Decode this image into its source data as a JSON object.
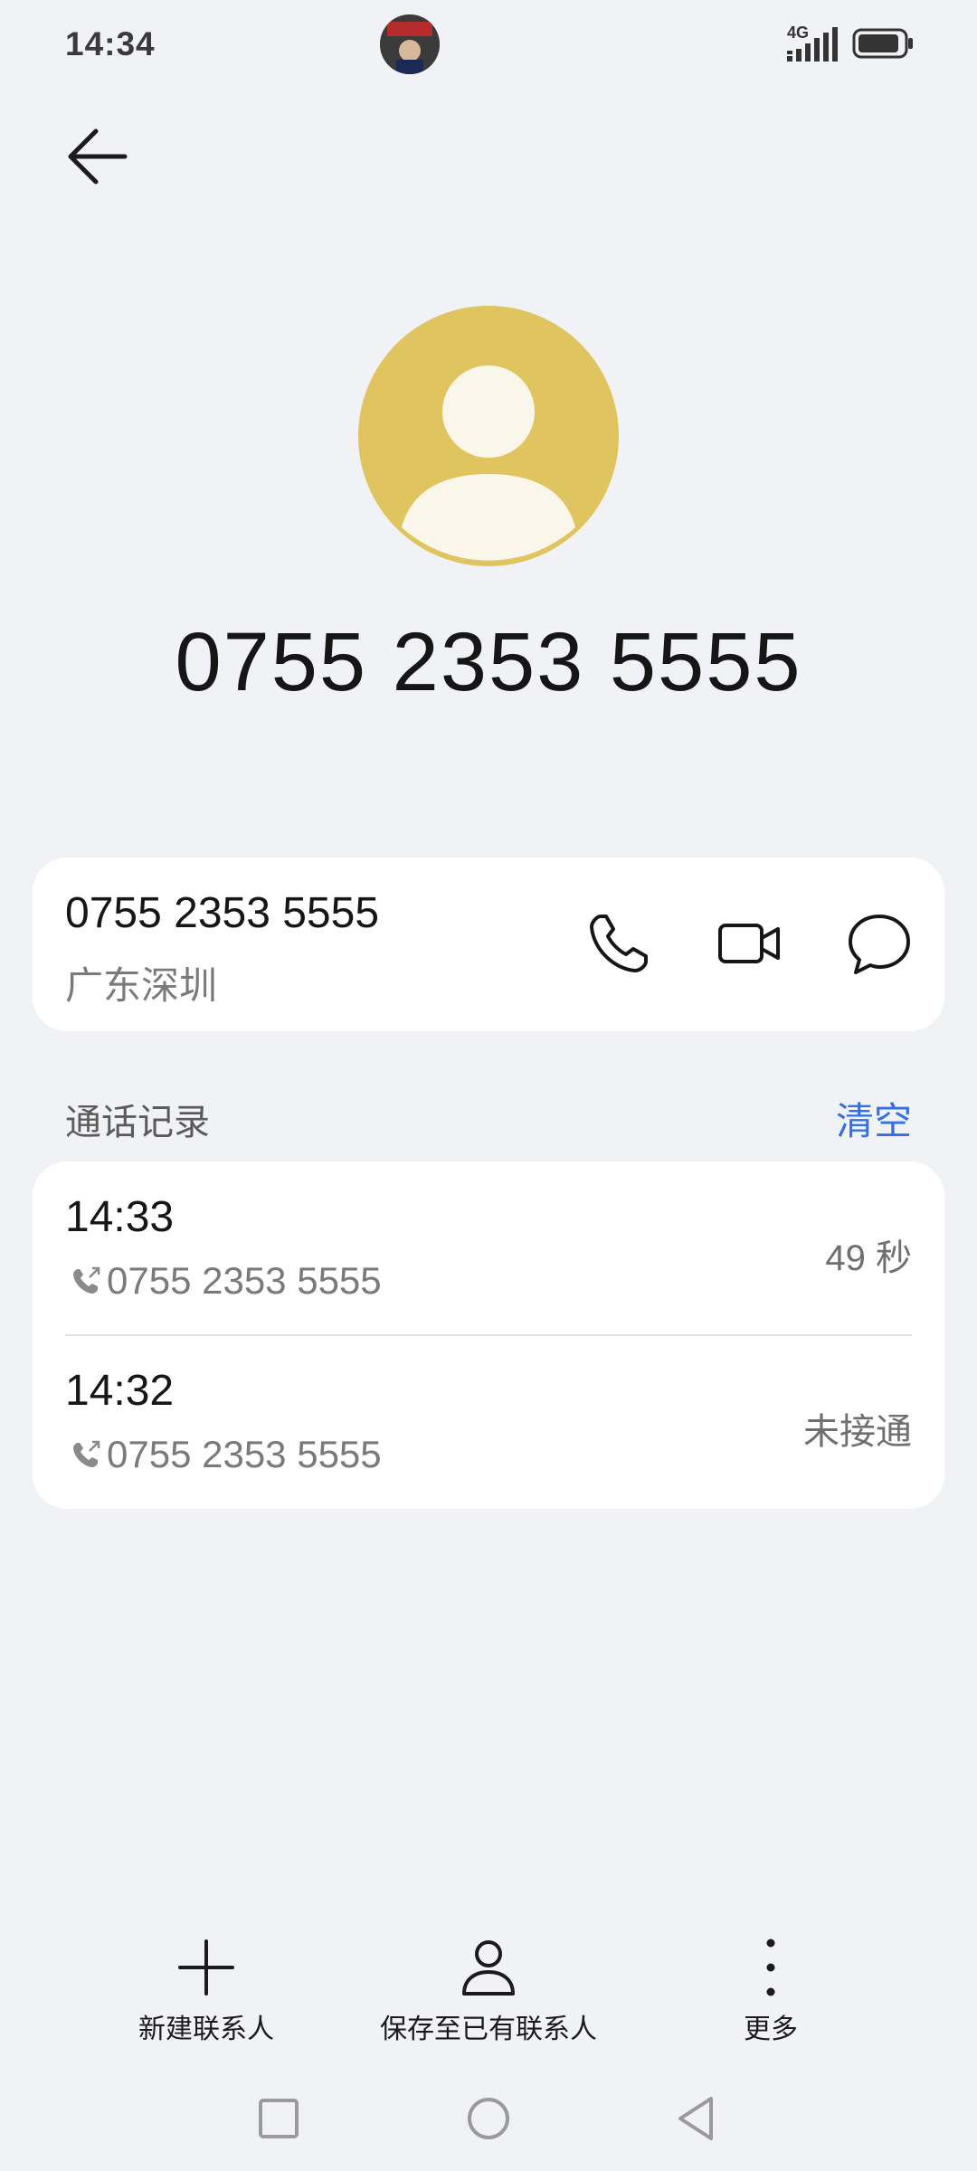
{
  "status_bar": {
    "time": "14:34",
    "network": "4G"
  },
  "contact": {
    "display_number": "0755 2353 5555",
    "number": "0755 2353 5555",
    "location": "广东深圳"
  },
  "call_log": {
    "title": "通话记录",
    "clear_label": "清空",
    "entries": [
      {
        "time": "14:33",
        "number": "0755 2353 5555",
        "status": "49 秒"
      },
      {
        "time": "14:32",
        "number": "0755 2353 5555",
        "status": "未接通"
      }
    ]
  },
  "bottom_actions": {
    "new_contact": "新建联系人",
    "save_existing": "保存至已有联系人",
    "more": "更多"
  },
  "colors": {
    "background": "#f1f2f6",
    "avatar": "#dfc45f",
    "accent": "#3470e0"
  }
}
